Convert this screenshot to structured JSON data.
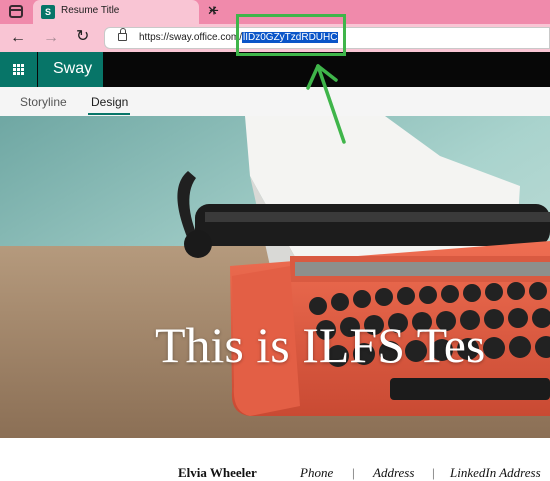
{
  "browser": {
    "tab": {
      "title": "Resume Title",
      "favicon_letter": "S"
    },
    "new_tab_symbol": "+",
    "close_symbol": "✕",
    "address": {
      "url_prefix": "https://sway.office.com/",
      "url_selected": "lIDz0GZyTzdRDUHC"
    }
  },
  "app": {
    "name": "Sway"
  },
  "tabs": [
    {
      "label": "Storyline"
    },
    {
      "label": "Design",
      "active": true
    }
  ],
  "hero": {
    "title": "This is ILFS Tes"
  },
  "contact": {
    "name": "Elvia Wheeler",
    "phone": "Phone",
    "separator": "|",
    "address": "Address",
    "linkedin": "LinkedIn Address"
  },
  "colors": {
    "tabstrip": "#f08aab",
    "toolbar": "#f9c5d4",
    "sway_green": "#077568",
    "selection": "#0a55c8",
    "annotation_green": "#3fb54a"
  },
  "icons": [
    "window-icon",
    "sway-favicon",
    "close-icon",
    "new-tab-icon",
    "back-icon",
    "forward-icon",
    "refresh-icon",
    "lock-icon",
    "waffle-icon"
  ]
}
